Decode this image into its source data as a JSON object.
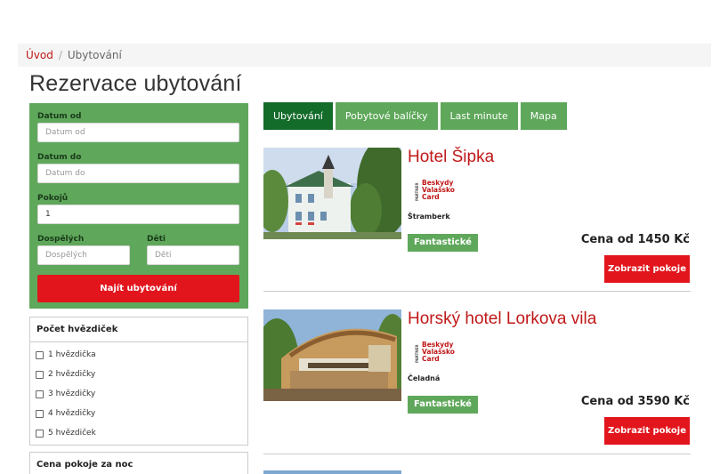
{
  "breadcrumb": {
    "home": "Úvod",
    "separator": "/",
    "current": "Ubytování"
  },
  "page_title": "Rezervace ubytování",
  "search": {
    "date_from_label": "Datum od",
    "date_from_placeholder": "Datum od",
    "date_to_label": "Datum do",
    "date_to_placeholder": "Datum do",
    "rooms_label": "Pokojů",
    "rooms_value": "1",
    "adults_label": "Dospělých",
    "adults_placeholder": "Dospělých",
    "children_label": "Děti",
    "children_placeholder": "Děti",
    "submit_label": "Najít ubytování"
  },
  "stars_filter": {
    "title": "Počet hvězdiček",
    "options": [
      "1 hvězdička",
      "2 hvězdičky",
      "3 hvězdičky",
      "4 hvězdičky",
      "5 hvězdiček"
    ]
  },
  "price_filter": {
    "title": "Cena pokoje za noc"
  },
  "tabs": [
    "Ubytování",
    "Pobytové balíčky",
    "Last minute",
    "Mapa"
  ],
  "hotels": [
    {
      "name": "Hotel Šipka",
      "partner_vertical": "PARTNER",
      "partner_lines": [
        "Beskydy",
        "Valašsko",
        "Card"
      ],
      "location": "Štramberk",
      "rating": "Fantastické",
      "price": "Cena od 1450 Kč",
      "button": "Zobrazit pokoje"
    },
    {
      "name": "Horský hotel Lorkova vila",
      "partner_vertical": "PARTNER",
      "partner_lines": [
        "Beskydy",
        "Valašsko",
        "Card"
      ],
      "location": "Čeladná",
      "rating": "Fantastické",
      "price": "Cena od 3590 Kč",
      "button": "Zobrazit pokoje"
    }
  ],
  "colors": {
    "accent_red": "#e2151d",
    "link_red": "#c01818",
    "green": "#5fa85b",
    "dark_green": "#146c2b"
  }
}
